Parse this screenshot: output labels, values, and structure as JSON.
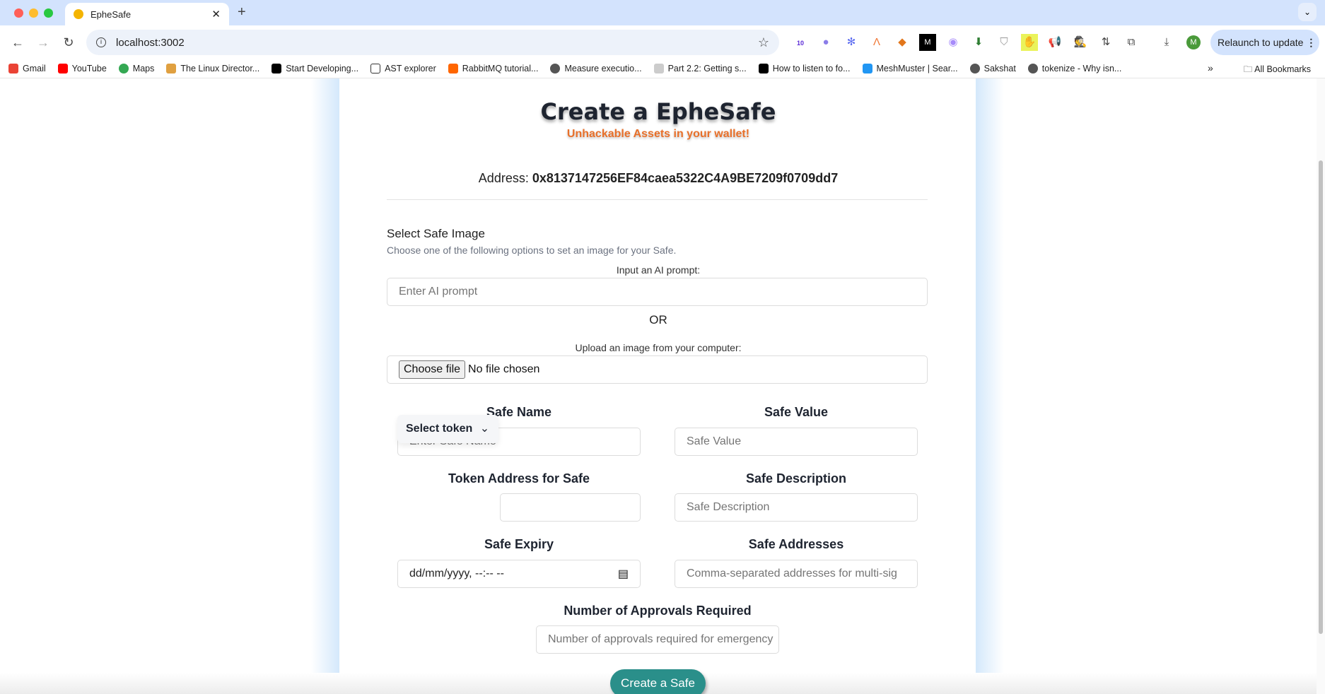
{
  "browser": {
    "tab_title": "EpheSafe",
    "url": "localhost:3002",
    "relaunch_label": "Relaunch to update",
    "avatar_letter": "M",
    "extension_badge": "10",
    "bookmarks": [
      "Gmail",
      "YouTube",
      "Maps",
      "The Linux Director...",
      "Start Developing...",
      "AST explorer",
      "RabbitMQ tutorial...",
      "Measure executio...",
      "Part 2.2: Getting s...",
      "How to listen to fo...",
      "MeshMuster | Sear...",
      "Sakshat",
      "tokenize - Why isn..."
    ],
    "all_bookmarks": "All Bookmarks"
  },
  "header": {
    "title": "Create a EpheSafe",
    "subtitle": "Unhackable Assets in your wallet!",
    "address_label": "Address:",
    "address_value": "0x8137147256EF84caea5322C4A9BE7209f0709dd7"
  },
  "image_section": {
    "title": "Select Safe Image",
    "hint": "Choose one of the following options to set an image for your Safe.",
    "ai_label": "Input an AI prompt:",
    "ai_placeholder": "Enter AI prompt",
    "or": "OR",
    "upload_label": "Upload an image from your computer:",
    "choose_file": "Choose file",
    "no_file": "No file chosen"
  },
  "form": {
    "safe_name_label": "Safe Name",
    "safe_name_placeholder": "Enter Safe Name",
    "safe_value_label": "Safe Value",
    "safe_value_placeholder": "Safe Value",
    "token_label": "Token Address for Safe",
    "token_select": "Select token",
    "description_label": "Safe Description",
    "description_placeholder": "Safe Description",
    "expiry_label": "Safe Expiry",
    "expiry_value": "dd/mm/yyyy, --:-- --",
    "addresses_label": "Safe Addresses",
    "addresses_placeholder": "Comma-separated addresses for multi-sig",
    "approvals_label": "Number of Approvals Required",
    "approvals_placeholder": "Number of approvals required for emergency",
    "submit": "Create a Safe"
  },
  "colors": {
    "accent": "#2a8f8a",
    "subtitle": "#e8702a",
    "glow": "#d4e8fb"
  }
}
